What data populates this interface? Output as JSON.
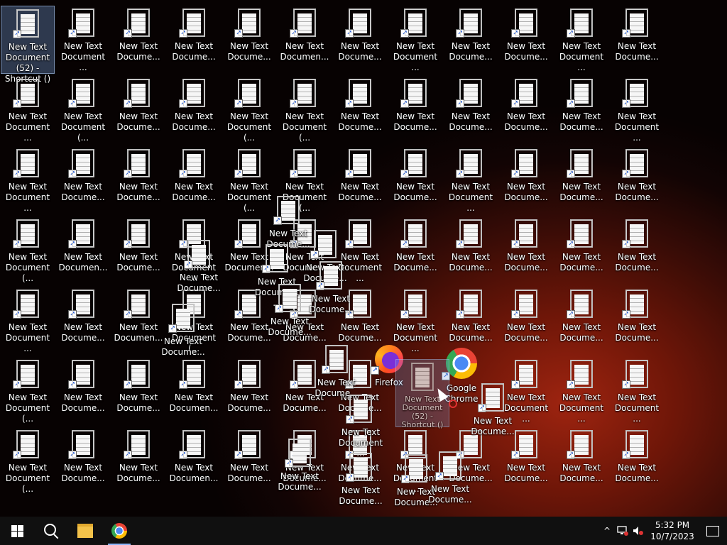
{
  "desktop": {
    "icons": [
      {
        "label": "New Text Document (52) - Shortcut ()",
        "type": "doc",
        "selected": true
      },
      {
        "label": "New Text\nDocument ...",
        "type": "doc"
      },
      {
        "label": "New Text\nDocume...",
        "type": "doc"
      },
      {
        "label": "New Text\nDocume...",
        "type": "doc"
      },
      {
        "label": "New Text\nDocume...",
        "type": "doc"
      },
      {
        "label": "New Text\nDocumen...",
        "type": "doc"
      },
      {
        "label": "New Text\nDocume...",
        "type": "doc"
      },
      {
        "label": "New Text\nDocument ...",
        "type": "doc"
      },
      {
        "label": "New Text\nDocume...",
        "type": "doc"
      },
      {
        "label": "New Text\nDocume...",
        "type": "doc"
      },
      {
        "label": "New Text\nDocument ...",
        "type": "doc"
      },
      {
        "label": "New Text\nDocume...",
        "type": "doc"
      },
      {
        "label": "New Text\nDocument ...",
        "type": "doc"
      },
      {
        "label": "New Text\nDocument (...",
        "type": "doc"
      },
      {
        "label": "New Text\nDocume...",
        "type": "doc"
      },
      {
        "label": "New Text\nDocume...",
        "type": "doc"
      },
      {
        "label": "New Text\nDocument (...",
        "type": "doc"
      },
      {
        "label": "New Text\nDocument (...",
        "type": "doc"
      },
      {
        "label": "New Text\nDocume...",
        "type": "doc"
      },
      {
        "label": "New Text\nDocume...",
        "type": "doc"
      },
      {
        "label": "New Text\nDocume...",
        "type": "doc"
      },
      {
        "label": "New Text\nDocume...",
        "type": "doc"
      },
      {
        "label": "New Text\nDocume...",
        "type": "doc"
      },
      {
        "label": "New Text\nDocument ...",
        "type": "doc"
      },
      {
        "label": "New Text\nDocument ...",
        "type": "doc"
      },
      {
        "label": "New Text\nDocume...",
        "type": "doc"
      },
      {
        "label": "New Text\nDocume...",
        "type": "doc"
      },
      {
        "label": "New Text\nDocume...",
        "type": "doc"
      },
      {
        "label": "New Text\nDocument (...",
        "type": "doc"
      },
      {
        "label": "New Text\nDocument (...",
        "type": "doc"
      },
      {
        "label": "New Text\nDocume...",
        "type": "doc"
      },
      {
        "label": "New Text\nDocume...",
        "type": "doc"
      },
      {
        "label": "New Text\nDocument ...",
        "type": "doc"
      },
      {
        "label": "New Text\nDocume...",
        "type": "doc"
      },
      {
        "label": "New Text\nDocume...",
        "type": "doc"
      },
      {
        "label": "New Text\nDocume...",
        "type": "doc"
      },
      {
        "label": "New Text\nDocument (...",
        "type": "doc"
      },
      {
        "label": "New Text\nDocumen...",
        "type": "doc"
      },
      {
        "label": "New Text\nDocume...",
        "type": "doc"
      },
      {
        "label": "New Text\nDocument ...",
        "type": "doc"
      },
      {
        "label": "New Text\nDocumen...",
        "type": "doc"
      },
      {
        "label": "New Text\nDocume...",
        "type": "doc"
      },
      {
        "label": "New Text\nDocument ...",
        "type": "doc"
      },
      {
        "label": "New Text\nDocume...",
        "type": "doc"
      },
      {
        "label": "New Text\nDocume...",
        "type": "doc"
      },
      {
        "label": "New Text\nDocume...",
        "type": "doc"
      },
      {
        "label": "New Text\nDocume...",
        "type": "doc"
      },
      {
        "label": "New Text\nDocume...",
        "type": "doc"
      },
      {
        "label": "New Text\nDocument ...",
        "type": "doc"
      },
      {
        "label": "New Text\nDocume...",
        "type": "doc"
      },
      {
        "label": "New Text\nDocumen...",
        "type": "doc"
      },
      {
        "label": "New Text\nDocument (...",
        "type": "doc"
      },
      {
        "label": "New Text\nDocume...",
        "type": "doc"
      },
      {
        "label": "New Text\nDocume...",
        "type": "doc"
      },
      {
        "label": "New Text\nDocume...",
        "type": "doc"
      },
      {
        "label": "New Text\nDocument ...",
        "type": "doc"
      },
      {
        "label": "New Text\nDocume...",
        "type": "doc"
      },
      {
        "label": "New Text\nDocume...",
        "type": "doc"
      },
      {
        "label": "New Text\nDocume...",
        "type": "doc"
      },
      {
        "label": "New Text\nDocume...",
        "type": "doc"
      },
      {
        "label": "New Text\nDocument (...",
        "type": "doc"
      },
      {
        "label": "New Text\nDocume...",
        "type": "doc"
      },
      {
        "label": "New Text\nDocume...",
        "type": "doc"
      },
      {
        "label": "New Text\nDocumen...",
        "type": "doc"
      },
      {
        "label": "New Text\nDocume...",
        "type": "doc"
      },
      {
        "label": "New Text\nDocume...",
        "type": "doc"
      },
      {
        "label": "New Text\nDocume...",
        "type": "doc"
      },
      {
        "label": "Firefox",
        "type": "firefox"
      },
      {
        "label": "Google\nChrome",
        "type": "chrome"
      },
      {
        "label": "New Text\nDocument ...",
        "type": "doc"
      },
      {
        "label": "New Text\nDocument ...",
        "type": "doc"
      },
      {
        "label": "New Text\nDocument ...",
        "type": "doc"
      },
      {
        "label": "New Text\nDocument (...",
        "type": "doc"
      },
      {
        "label": "New Text\nDocume...",
        "type": "doc"
      },
      {
        "label": "New Text\nDocume...",
        "type": "doc"
      },
      {
        "label": "New Text\nDocumen...",
        "type": "doc"
      },
      {
        "label": "New Text\nDocume...",
        "type": "doc"
      },
      {
        "label": "New Text\nDocume...",
        "type": "doc"
      },
      {
        "label": "New Text\nDocume...",
        "type": "doc"
      },
      {
        "label": "New Text\nDocument ...",
        "type": "doc"
      },
      {
        "label": "New Text\nDocume...",
        "type": "doc"
      },
      {
        "label": "New Text\nDocume...",
        "type": "doc"
      },
      {
        "label": "New Text\nDocume...",
        "type": "doc"
      },
      {
        "label": "New Text\nDocume...",
        "type": "doc"
      },
      {
        "label": "New Text\nDocume...",
        "type": "doc"
      },
      {
        "label": "New Text\nDocume...",
        "type": "doc"
      },
      {
        "label": "New Text\nDocument ...",
        "type": "doc"
      },
      {
        "label": "New Text\nDocume...",
        "type": "doc"
      },
      {
        "label": "New Text\nDocume...",
        "type": "doc"
      },
      {
        "label": "New Text\nDocume...",
        "type": "doc"
      },
      {
        "label": "New Text\nDocume...",
        "type": "doc"
      },
      {
        "label": "New Text\nDocume...",
        "type": "doc"
      },
      {
        "label": "New Text\nDocument ...",
        "type": "doc"
      },
      {
        "label": "New Text\nDocume...",
        "type": "doc"
      },
      {
        "label": "New Text\nDocume...",
        "type": "doc"
      },
      {
        "label": "New Text\nDocume...",
        "type": "doc"
      },
      {
        "label": "New Text\nDocume...",
        "type": "doc"
      },
      {
        "label": "New Text\nDocume...",
        "type": "doc"
      }
    ],
    "drag_ghost_label": "New Text Document (52) - Shortcut ()"
  },
  "taskbar": {
    "start_icon": "windows-logo-icon",
    "search_icon": "search-icon",
    "pinned": [
      {
        "name": "file-explorer",
        "icon": "folder-icon"
      },
      {
        "name": "google-chrome",
        "icon": "chrome-icon"
      }
    ],
    "tray": {
      "chevron": "^",
      "time": "5:32 PM",
      "date": "10/7/2023"
    }
  },
  "colors": {
    "taskbar_bg": "#101010",
    "selection": "#78a0dc",
    "accent": "#8ab4f8"
  }
}
